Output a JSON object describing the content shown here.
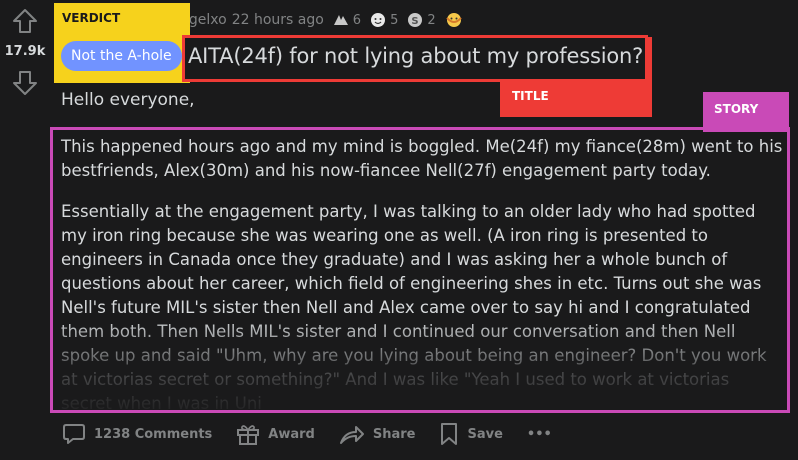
{
  "vote": {
    "score": "17.9k"
  },
  "meta": {
    "author": "ngelxo",
    "time": "22 hours ago",
    "awards": [
      {
        "icon": "helpful-award-icon",
        "count": "6"
      },
      {
        "icon": "wholesome-award-icon",
        "count": "5"
      },
      {
        "icon": "silver-award-icon",
        "count": "2"
      },
      {
        "icon": "hugz-award-icon",
        "count": ""
      }
    ]
  },
  "annotations": {
    "verdict": "VERDICT",
    "title": "TITLE",
    "story": "STORY"
  },
  "post": {
    "flair": "Not the A-hole",
    "title": "AITA(24f) for not lying about my profession?",
    "greeting": "Hello everyone,",
    "paragraphs": [
      "This happened hours ago and my mind is boggled. Me(24f) my fiance(28m) went to his bestfriends, Alex(30m) and his now-fiancee Nell(27f) engagement party today.",
      "Essentially at the engagement party, I was talking to an older lady who had spotted my iron ring because she was wearing one as well. (A iron ring is presented to engineers in Canada once they graduate) and I was asking her a whole bunch of questions about her career, which field of engineering shes in etc. Turns out she was Nell's future MIL's sister then Nell and Alex came over to say hi and I congratulated them both. Then Nells MIL's sister and I continued our conversation and then Nell spoke up and said \"Uhm, why are you lying about being an engineer? Don't you work at victorias secret or something?\" And I was like \"Yeah I used to work at victorias secret when I was in Uni"
    ]
  },
  "actions": {
    "comments": "1238 Comments",
    "award": "Award",
    "share": "Share",
    "save": "Save",
    "more": "•••"
  }
}
